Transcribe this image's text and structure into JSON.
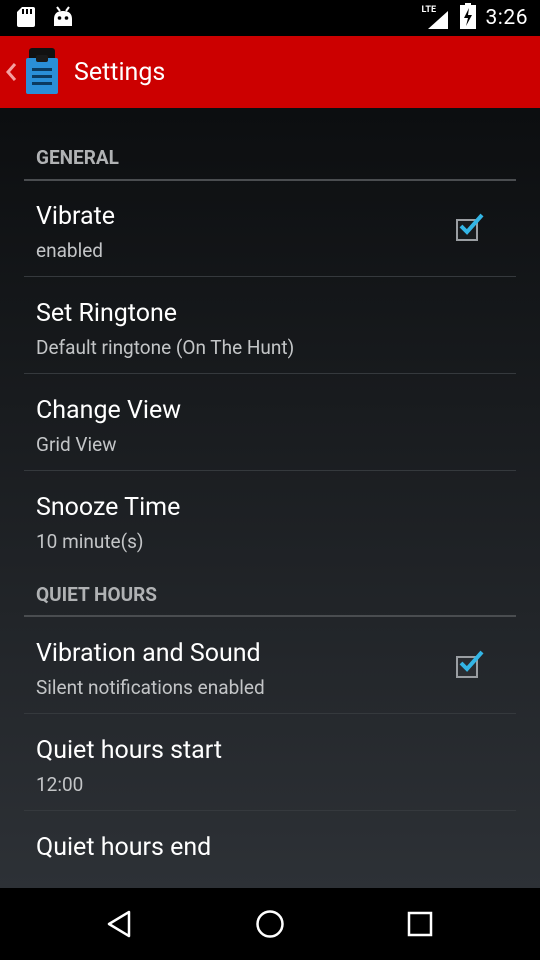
{
  "status_bar": {
    "time": "3:26",
    "network_label": "LTE",
    "icons": [
      "sd-card-icon",
      "android-debug-icon",
      "lte-signal-icon",
      "battery-charging-icon"
    ]
  },
  "action_bar": {
    "title": "Settings",
    "background_color": "#cc0000",
    "app_icon": "clipboard-document-icon",
    "app_icon_color": "#2a8fd8"
  },
  "sections": [
    {
      "header": "GENERAL",
      "items": [
        {
          "title": "Vibrate",
          "summary": "enabled",
          "has_checkbox": true,
          "checked": true
        },
        {
          "title": "Set Ringtone",
          "summary": "Default ringtone (On The Hunt)",
          "has_checkbox": false
        },
        {
          "title": "Change View",
          "summary": "Grid View",
          "has_checkbox": false
        },
        {
          "title": "Snooze Time",
          "summary": "10 minute(s)",
          "has_checkbox": false
        }
      ]
    },
    {
      "header": "QUIET HOURS",
      "items": [
        {
          "title": "Vibration and Sound",
          "summary": "Silent notifications enabled",
          "has_checkbox": true,
          "checked": true
        },
        {
          "title": "Quiet hours start",
          "summary": "12:00",
          "has_checkbox": false
        },
        {
          "title": "Quiet hours end",
          "summary": "",
          "has_checkbox": false
        }
      ]
    }
  ],
  "checkbox_accent_color": "#33b5e5",
  "nav_bar": {
    "buttons": [
      "back-icon",
      "home-icon",
      "recents-icon"
    ]
  }
}
